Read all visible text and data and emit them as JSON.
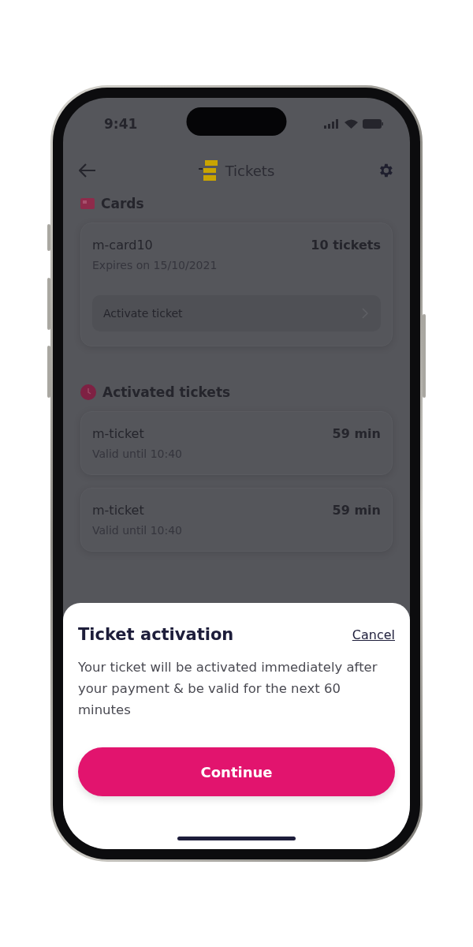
{
  "status_bar": {
    "time": "9:41"
  },
  "header": {
    "title": "Tickets"
  },
  "sections": [
    {
      "kind": "cards",
      "title": "Cards",
      "items": [
        {
          "name": "m-card10",
          "count": "10 tickets",
          "detail": "Expires on 15/10/2021",
          "action": "Activate ticket"
        }
      ]
    },
    {
      "kind": "activated",
      "title": "Activated tickets",
      "items": [
        {
          "name": "m-ticket",
          "count": "59 min",
          "detail": "Valid until 10:40"
        },
        {
          "name": "m-ticket",
          "count": "59 min",
          "detail": "Valid until 10:40"
        }
      ]
    }
  ],
  "sheet": {
    "title": "Ticket activation",
    "cancel": "Cancel",
    "message": "Your ticket will be activated immediately after your payment & be valid for the next 60 minutes",
    "button": "Continue"
  }
}
